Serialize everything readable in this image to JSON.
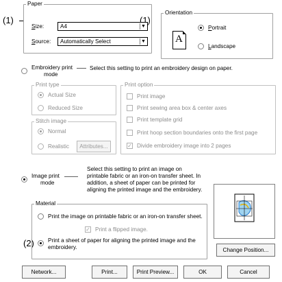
{
  "callouts": {
    "paper": "(1)",
    "orientation": "(1)",
    "alignment": "(2)"
  },
  "paper": {
    "title": "Paper",
    "size_label": "Size:",
    "size_value": "A4",
    "source_label": "Source:",
    "source_value": "Automatically Select"
  },
  "orientation": {
    "title": "Orientation",
    "portrait": "Portrait",
    "landscape": "Landscape",
    "selected": "portrait",
    "icon_letter": "A"
  },
  "embroidery": {
    "radio_label_1": "Embroidery print",
    "radio_label_2": "mode",
    "description": "Select this setting to print an embroidery design on paper.",
    "print_type": {
      "title": "Print type",
      "actual_size": "Actual Size",
      "reduced_size": "Reduced Size"
    },
    "stitch_image": {
      "title": "Stitch image",
      "normal": "Normal",
      "realistic": "Realistic",
      "attributes_button": "Attributes..."
    },
    "print_option": {
      "title": "Print option",
      "items": [
        "Print image",
        "Print sewing area box & center axes",
        "Print template grid",
        "Print hoop section boundaries onto the first page",
        "Divide embroidery image into 2 pages"
      ]
    }
  },
  "image_print": {
    "radio_label_1": "Image print",
    "radio_label_2": "mode",
    "description": [
      "Select this setting to print an image on",
      "printable fabric or an iron-on transfer sheet. In",
      "addition, a sheet of paper can be printed for",
      "aligning the printed image and the embroidery."
    ]
  },
  "material": {
    "title": "Material",
    "option1": "Print the image on printable fabric or an iron-on transfer sheet.",
    "flipped": "Print a flipped image.",
    "option2_line1": "Print a sheet of paper for aligning the printed image and the",
    "option2_line2": "embroidery."
  },
  "buttons": {
    "change_position": "Change Position...",
    "network": "Network...",
    "print": "Print...",
    "print_preview": "Print Preview...",
    "ok": "OK",
    "cancel": "Cancel"
  }
}
